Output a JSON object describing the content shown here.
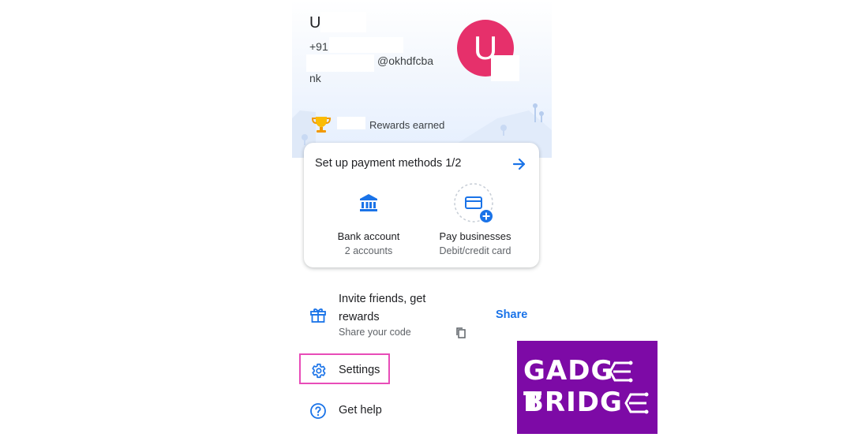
{
  "profile": {
    "name_initial": "U",
    "phone_prefix": "+91",
    "upi_suffix": "@okhdfcba",
    "bank_short": "nk",
    "avatar_letter": "U",
    "avatar_color": "#e6306b",
    "rewards_label": "Rewards earned"
  },
  "payment_setup": {
    "title": "Set up payment methods 1/2",
    "options": [
      {
        "label": "Bank account",
        "sub": "2 accounts",
        "icon": "bank-icon"
      },
      {
        "label": "Pay businesses",
        "sub": "Debit/credit card",
        "icon": "card-add-icon"
      }
    ]
  },
  "invite": {
    "title": "Invite friends, get rewards",
    "sub": "Share your code",
    "action": "Share"
  },
  "menu": {
    "settings": "Settings",
    "help": "Get help"
  },
  "watermark": {
    "line1": "GADG",
    "line1_end": "T",
    "line2": "BRIDG"
  },
  "colors": {
    "accent": "#1a73e8",
    "highlight": "#e84cb8",
    "watermark_bg": "#7d0aa6"
  }
}
